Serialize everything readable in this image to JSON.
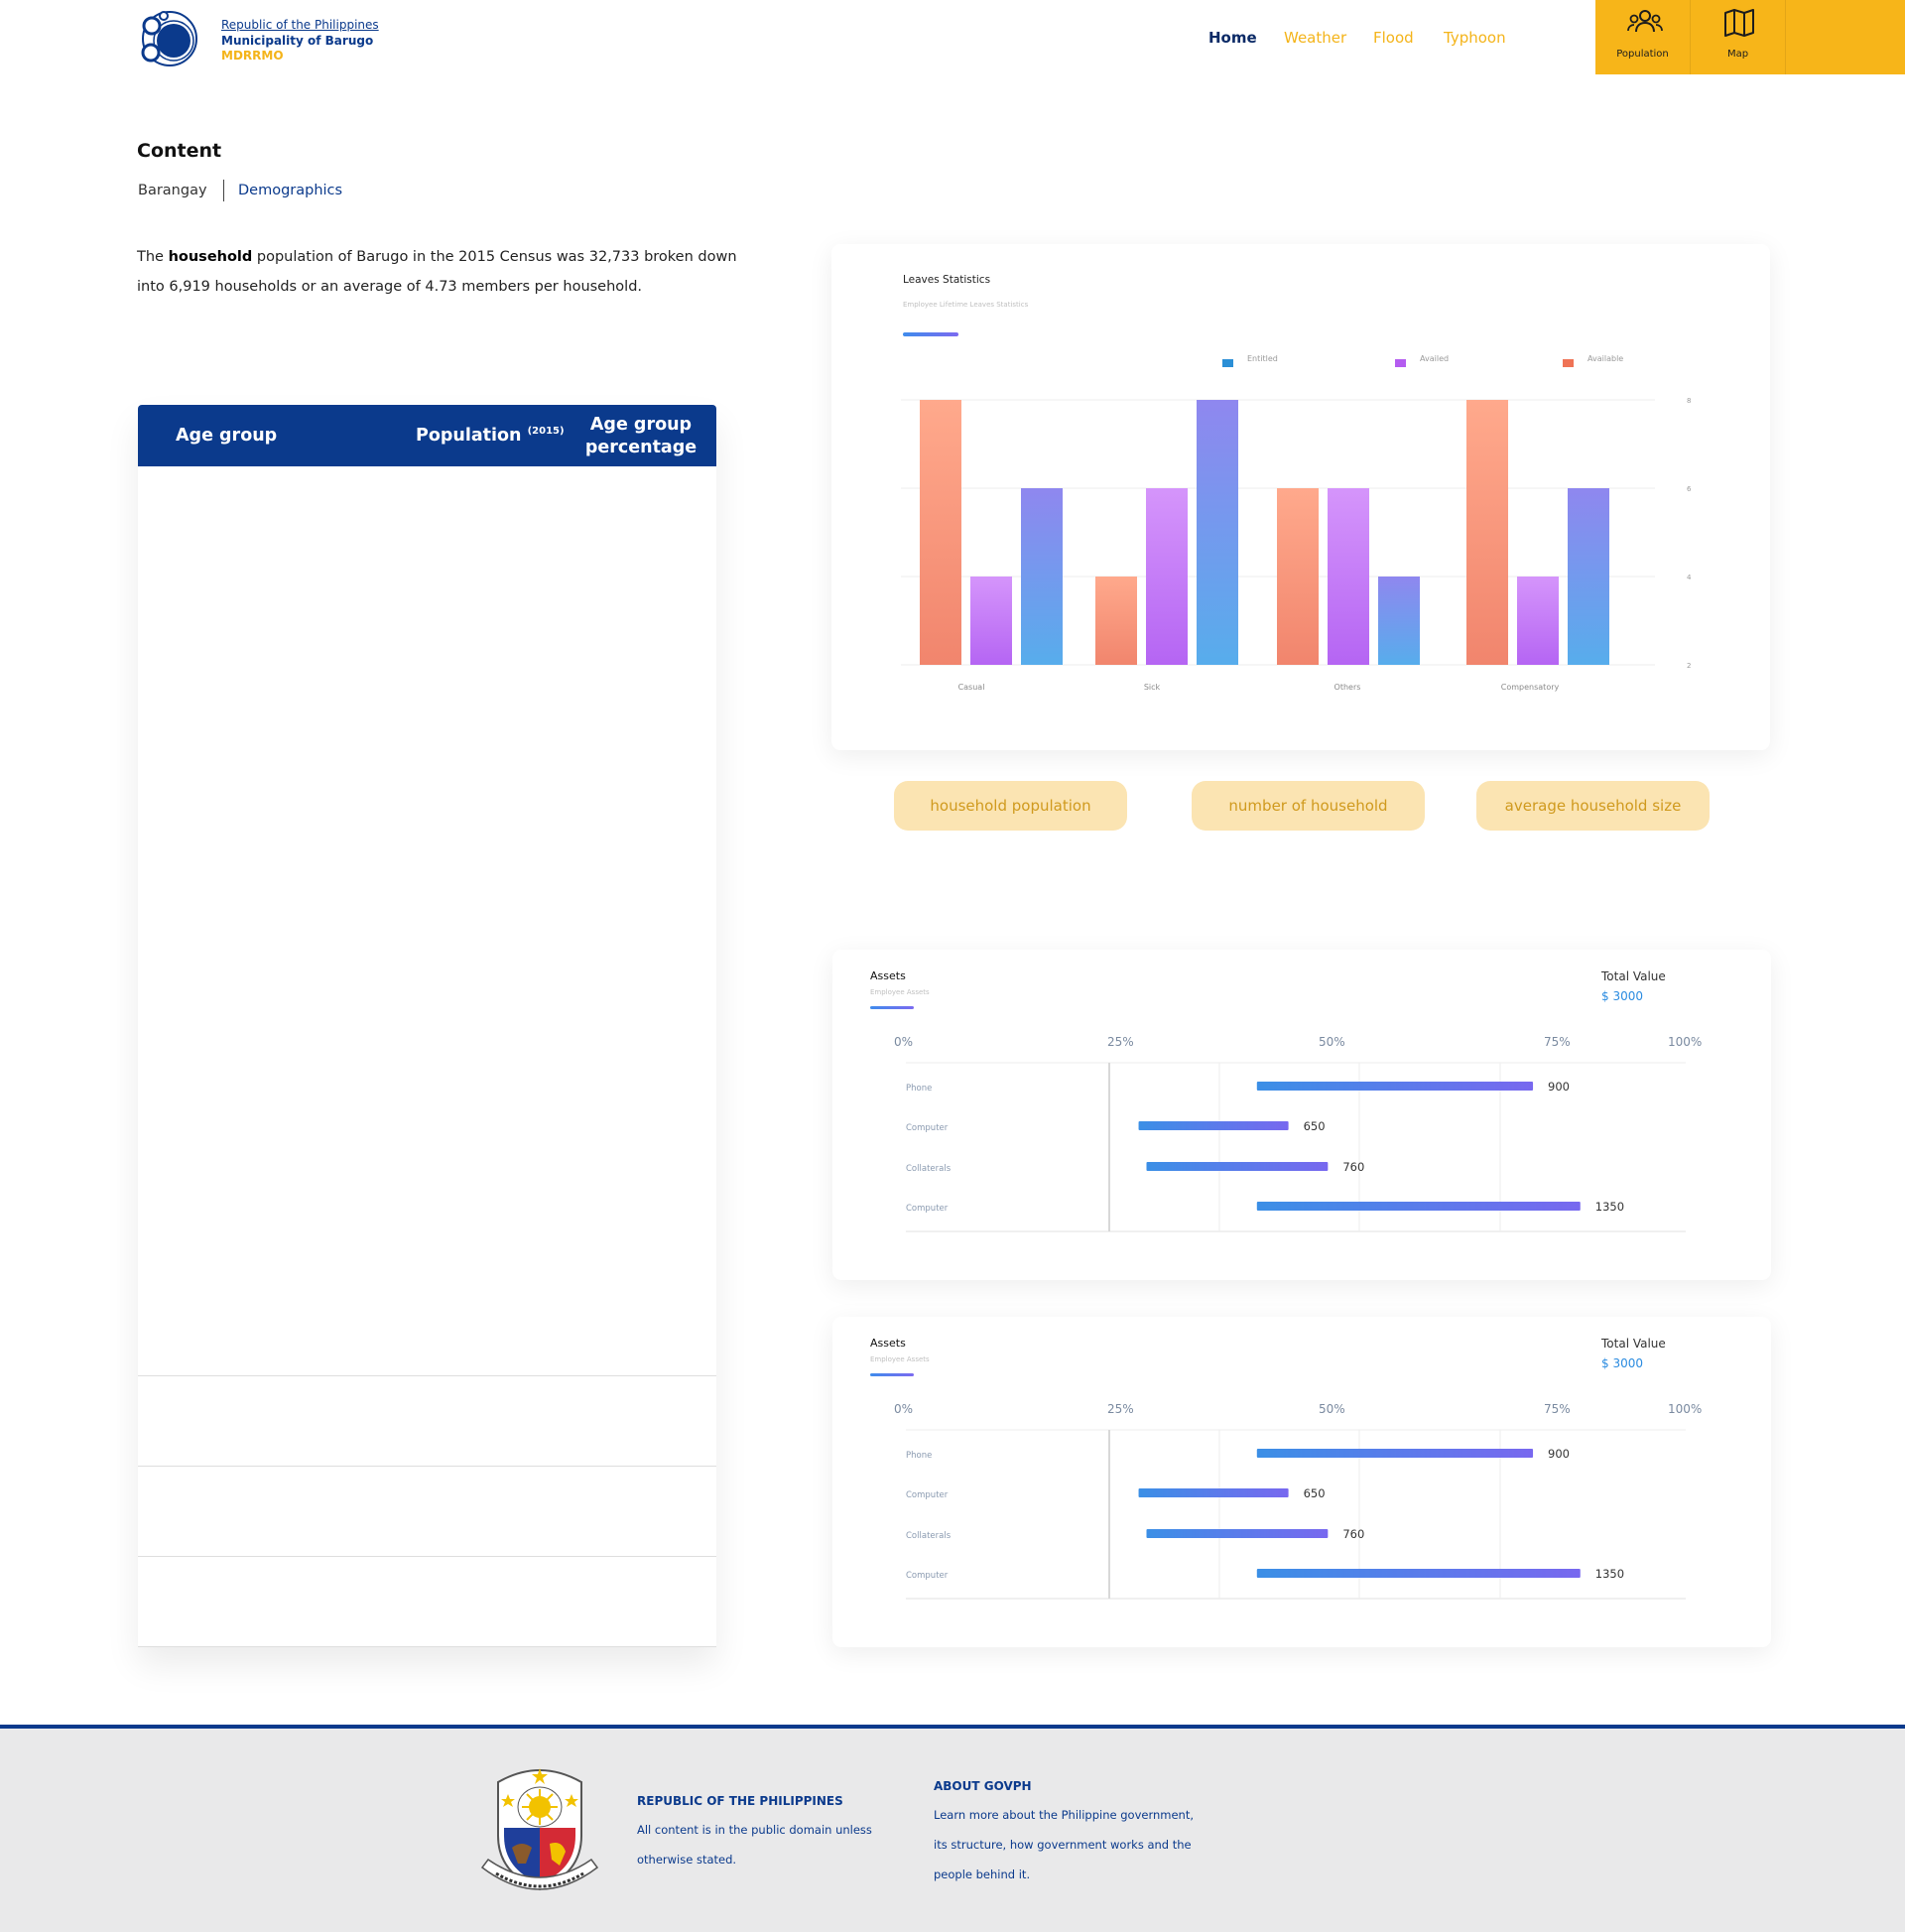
{
  "header": {
    "brand": {
      "line1": "Republic of the Philippines",
      "line2": "Municipality of Barugo",
      "line3": "MDRRMO"
    },
    "nav": [
      "Home",
      "Weather",
      "Flood",
      "Typhoon"
    ],
    "quick_links": [
      {
        "label": "Population",
        "icon": "population-icon"
      },
      {
        "label": "Map",
        "icon": "map-icon"
      }
    ]
  },
  "content": {
    "title": "Content",
    "tabs": [
      "Barangay",
      "Demographics"
    ],
    "intro": {
      "before": "The ",
      "bold": "household",
      "after": " population of Barugo in the 2015 Census was 32,733 broken down into 6,919 households or an average of 4.73 members per household."
    }
  },
  "table": {
    "headers": {
      "age_group": "Age group",
      "population": "Population",
      "population_sup": "(2015)",
      "percentage_line1": "Age group",
      "percentage_line2": "percentage"
    },
    "rows": []
  },
  "pills": [
    "household population",
    "number of household",
    "average household size"
  ],
  "colors": {
    "brand_blue": "#0b3a8c",
    "accent_yellow": "#f7b519",
    "pill_bg": "#fbe4b2",
    "pill_text": "#d09a1e",
    "entitled": "#2b8fd6",
    "availed": "#b45cf0",
    "available": "#ef7355"
  },
  "chart_data": [
    {
      "type": "bar",
      "title": "Leaves Statistics",
      "subtitle": "Employee Lifetime Leaves Statistics",
      "categories": [
        "Casual",
        "Sick",
        "Others",
        "Compensatory"
      ],
      "series": [
        {
          "name": "Available",
          "values": [
            8,
            4,
            6,
            8
          ]
        },
        {
          "name": "Availed",
          "values": [
            4,
            6,
            6,
            4
          ]
        },
        {
          "name": "Entitled",
          "values": [
            6,
            8,
            4,
            6
          ]
        }
      ],
      "legend_order": [
        "Entitled",
        "Availed",
        "Available"
      ],
      "legend": "top",
      "ylim": [
        2,
        8
      ],
      "yticks": [
        8,
        6,
        4,
        2
      ],
      "y_axis_side": "right",
      "grid": true
    },
    {
      "type": "bar",
      "orientation": "horizontal",
      "title": "Assets",
      "subtitle": "Employee Assets",
      "total_label": "Total Value",
      "total_value": "$ 3000",
      "xticks": [
        "0%",
        "25%",
        "50%",
        "75%",
        "100%"
      ],
      "items": [
        {
          "label": "Phone",
          "value": "900",
          "start_pct": 44,
          "end_pct": 79
        },
        {
          "label": "Computer",
          "value": "650",
          "start_pct": 29,
          "end_pct": 48
        },
        {
          "label": "Collaterals",
          "value": "760",
          "start_pct": 30,
          "end_pct": 53
        },
        {
          "label": "Computer",
          "value": "1350",
          "start_pct": 44,
          "end_pct": 85
        }
      ]
    },
    {
      "type": "bar",
      "orientation": "horizontal",
      "title": "Assets",
      "subtitle": "Employee Assets",
      "total_label": "Total Value",
      "total_value": "$ 3000",
      "xticks": [
        "0%",
        "25%",
        "50%",
        "75%",
        "100%"
      ],
      "items": [
        {
          "label": "Phone",
          "value": "900",
          "start_pct": 44,
          "end_pct": 79
        },
        {
          "label": "Computer",
          "value": "650",
          "start_pct": 29,
          "end_pct": 48
        },
        {
          "label": "Collaterals",
          "value": "760",
          "start_pct": 30,
          "end_pct": 53
        },
        {
          "label": "Computer",
          "value": "1350",
          "start_pct": 44,
          "end_pct": 85
        }
      ]
    }
  ],
  "footer": {
    "col1": {
      "heading": "REPUBLIC OF THE PHILIPPINES",
      "text": "All content is in the public domain unless otherwise stated."
    },
    "col2": {
      "heading": "ABOUT GOVPH",
      "text": "Learn more about the Philippine government, its structure, how government works and the people behind it."
    },
    "seal_text": "REPUBLIKA NG PILIPINAS"
  }
}
